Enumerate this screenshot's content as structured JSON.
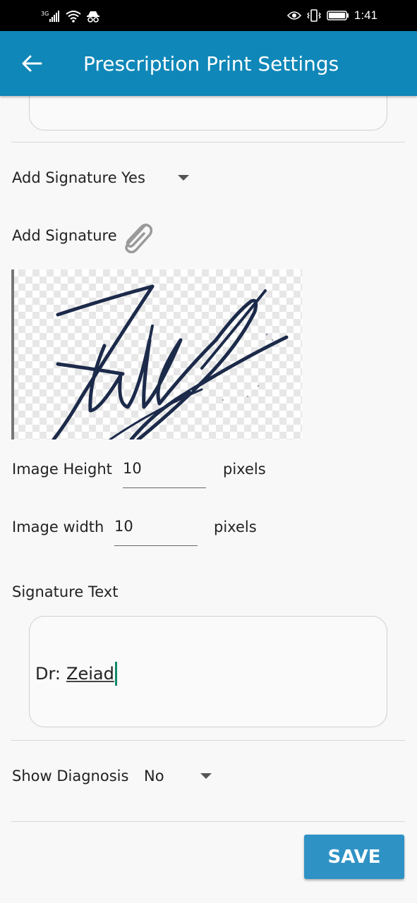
{
  "status_bar": {
    "network": "3G",
    "time": "1:41"
  },
  "header": {
    "title": "Prescription Print Settings",
    "back_icon": "arrow-left-icon"
  },
  "add_signature_toggle": {
    "label": "Add Signature",
    "value": "Yes"
  },
  "add_signature_file": {
    "label": "Add Signature",
    "icon": "paperclip-icon"
  },
  "image_height": {
    "label": "Image Height",
    "value": "10",
    "unit": "pixels"
  },
  "image_width": {
    "label": "Image width",
    "value": "10",
    "unit": "pixels"
  },
  "signature_text": {
    "label": "Signature Text",
    "prefix": "Dr:",
    "name": "Zeiad"
  },
  "show_diagnosis": {
    "label": "Show Diagnosis",
    "value": "No"
  },
  "save_label": "SAVE",
  "colors": {
    "appbar": "#0f87b8",
    "save_button": "#2f92c5",
    "cursor": "#0f8a6a"
  }
}
